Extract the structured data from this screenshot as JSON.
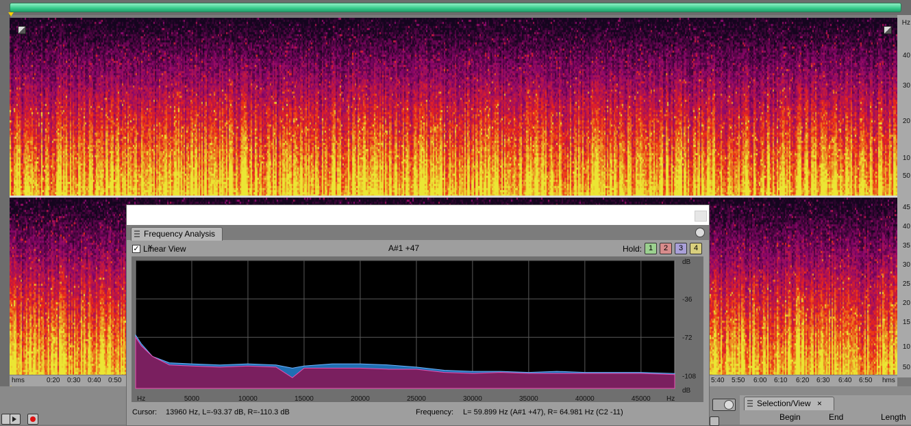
{
  "colors": {
    "progress": "#36c98a",
    "marker": "#f5d000",
    "spectrum_left": "#1f6fb3",
    "spectrum_right": "#7a1f5f",
    "spectrum_right_line": "#e84fb0",
    "plot_bg": "#000000",
    "hold1": "#9bd08f",
    "hold2": "#d78c8c",
    "hold3": "#a9a0d8",
    "hold4": "#d9cf7d"
  },
  "waveform_time_axis": {
    "start_label": "hms",
    "end_label": "hms",
    "ticks_left": [
      "0:20",
      "0:30",
      "0:40",
      "0:50"
    ],
    "ticks_right": [
      "5:40",
      "5:50",
      "6:00",
      "6:10",
      "6:20",
      "6:30",
      "6:40",
      "6:50"
    ]
  },
  "hz_axis": {
    "top_unit": "Hz",
    "upper_ticks": [
      "40",
      "30",
      "20",
      "10",
      "50"
    ],
    "lower_ticks": [
      "45",
      "40",
      "35",
      "30",
      "25",
      "20",
      "15",
      "10",
      "50"
    ]
  },
  "frequency_panel": {
    "tab_title": "Frequency Analysis",
    "tab_close": "×",
    "linear_view_label": "Linear View",
    "linear_view_checked": "✓",
    "note_readout": "A#1 +47",
    "hold_label": "Hold:",
    "hold_buttons": [
      "1",
      "2",
      "3",
      "4"
    ],
    "db_labels": [
      "dB",
      "-36",
      "-72",
      "-108",
      "dB"
    ],
    "x_unit_left": "Hz",
    "x_unit_right": "Hz",
    "x_ticks": [
      "5000",
      "10000",
      "15000",
      "20000",
      "25000",
      "30000",
      "35000",
      "40000",
      "45000"
    ],
    "cursor_label": "Cursor:",
    "cursor_value": "13960 Hz, L=-93.37 dB, R=-110.3 dB",
    "frequency_label": "Frequency:",
    "frequency_value": "L= 59.899 Hz (A#1 +47), R= 64.981 Hz (C2 -11)"
  },
  "selection_panel": {
    "tab_title": "Selection/View",
    "tab_close": "×",
    "columns": [
      "Begin",
      "End",
      "Length"
    ]
  },
  "chart_data": {
    "type": "area",
    "xlabel": "Hz",
    "ylabel": "dB",
    "xlim": [
      0,
      48000
    ],
    "ylim": [
      -120,
      0
    ],
    "x": [
      0,
      500,
      1500,
      3000,
      5000,
      7500,
      10000,
      12500,
      13960,
      15000,
      17500,
      20000,
      22500,
      25000,
      27500,
      30000,
      32500,
      35000,
      37500,
      40000,
      42500,
      45000,
      48000
    ],
    "series": [
      {
        "name": "L",
        "values": [
          -70,
          -78,
          -90,
          -96,
          -97,
          -98,
          -97,
          -98,
          -101,
          -99,
          -97,
          -97,
          -98,
          -100,
          -103,
          -104,
          -104,
          -105,
          -104,
          -105,
          -105,
          -105,
          -106
        ]
      },
      {
        "name": "R",
        "values": [
          -72,
          -80,
          -90,
          -98,
          -99,
          -100,
          -99,
          -100,
          -110,
          -101,
          -101,
          -101,
          -102,
          -102,
          -105,
          -106,
          -105,
          -106,
          -106,
          -106,
          -106,
          -106,
          -107
        ]
      }
    ]
  }
}
